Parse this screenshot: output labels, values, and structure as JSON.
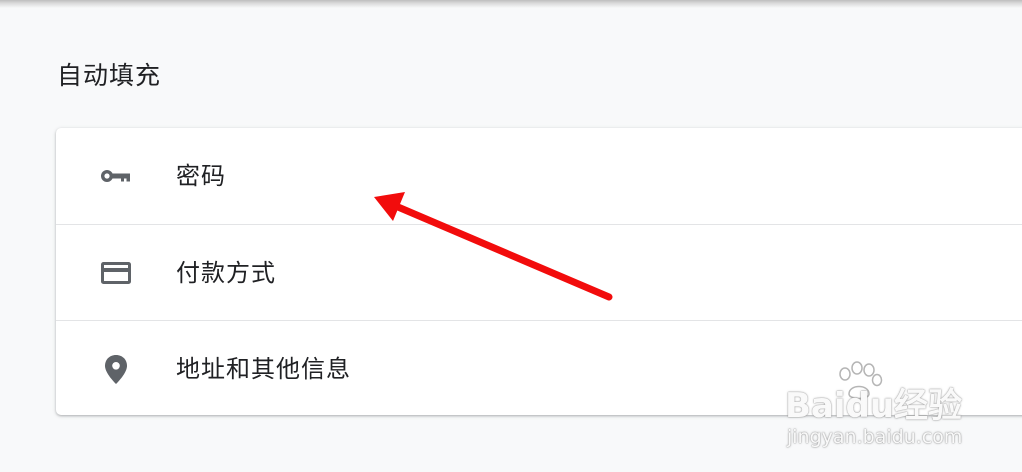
{
  "autofill": {
    "title": "自动填充",
    "items": [
      {
        "icon": "key-icon",
        "label": "密码"
      },
      {
        "icon": "credit-card-icon",
        "label": "付款方式"
      },
      {
        "icon": "location-pin-icon",
        "label": "地址和其他信息"
      }
    ]
  },
  "annotation": {
    "arrow_color": "#f20c0c"
  },
  "watermark": {
    "brand": "Baidu经验",
    "url": "jingyan.baidu.com"
  },
  "colors": {
    "icon": "#5f6368",
    "text": "#202124",
    "background": "#f8f9fa",
    "card": "#ffffff"
  }
}
